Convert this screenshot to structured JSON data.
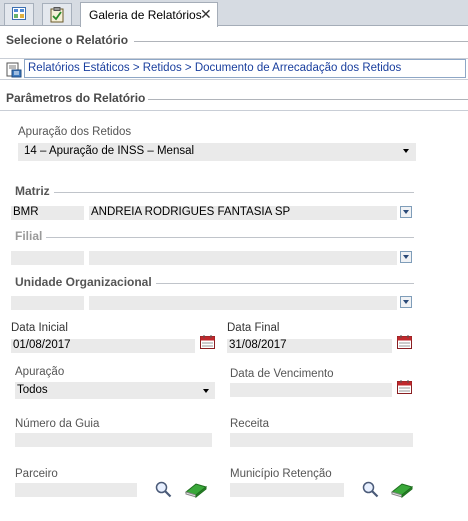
{
  "tabs": {
    "active_label": "Galeria de Relatórios",
    "close_glyph": "✕"
  },
  "sections": {
    "select_report": "Selecione o Relatório",
    "params": "Parâmetros do Relatório"
  },
  "breadcrumb": "Relatórios Estáticos > Retidos > Documento de Arrecadação dos Retidos",
  "apuracao_retidos": {
    "label": "Apuração dos Retidos",
    "value": "14 – Apuração de INSS – Mensal"
  },
  "matriz": {
    "label": "Matriz",
    "code": "BMR",
    "name": "ANDREIA RODRIGUES FANTASIA SP"
  },
  "filial": {
    "label": "Filial",
    "code": "",
    "name": ""
  },
  "unidade": {
    "label": "Unidade Organizacional",
    "code": "",
    "name": ""
  },
  "data_inicial": {
    "label": "Data Inicial",
    "value": "01/08/2017"
  },
  "data_final": {
    "label": "Data Final",
    "value": "31/08/2017"
  },
  "apuracao": {
    "label": "Apuração",
    "value": "Todos"
  },
  "data_vencimento": {
    "label": "Data de Vencimento",
    "value": ""
  },
  "numero_guia": {
    "label": "Número da Guia",
    "value": ""
  },
  "receita": {
    "label": "Receita",
    "value": ""
  },
  "parceiro": {
    "label": "Parceiro",
    "value": ""
  },
  "municipio": {
    "label": "Município Retenção",
    "value": ""
  },
  "colors": {
    "accent": "#1a3f9e",
    "field_bg": "#eaeaea",
    "calendar_red": "#c0282c",
    "eraser_green": "#3aa83a"
  }
}
